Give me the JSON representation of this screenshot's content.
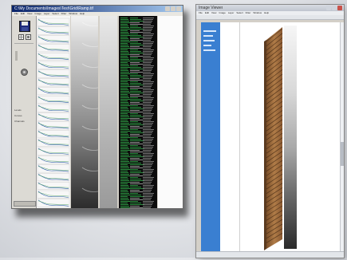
{
  "left_window": {
    "title": "C:\\My Documents\\Images\\Test\\Grid\\Ramp.tif",
    "menu": [
      "File",
      "Edit",
      "View",
      "Image",
      "Layer",
      "Select",
      "Filter",
      "Window",
      "Help"
    ],
    "side_labels": [
      "Levels",
      "Curves",
      "Channels"
    ]
  },
  "right_window": {
    "title": "Image Viewer",
    "menu": [
      "File",
      "Edit",
      "View",
      "Image",
      "Layer",
      "Select",
      "Filter",
      "Window",
      "Help"
    ]
  },
  "colors": {
    "titlebar": "#0a246a",
    "titlebar_end": "#a6caf0",
    "sidebar_blue": "#3a7fd1",
    "terminal_green": "#3bd35a",
    "wood": "#9a6a3c"
  }
}
